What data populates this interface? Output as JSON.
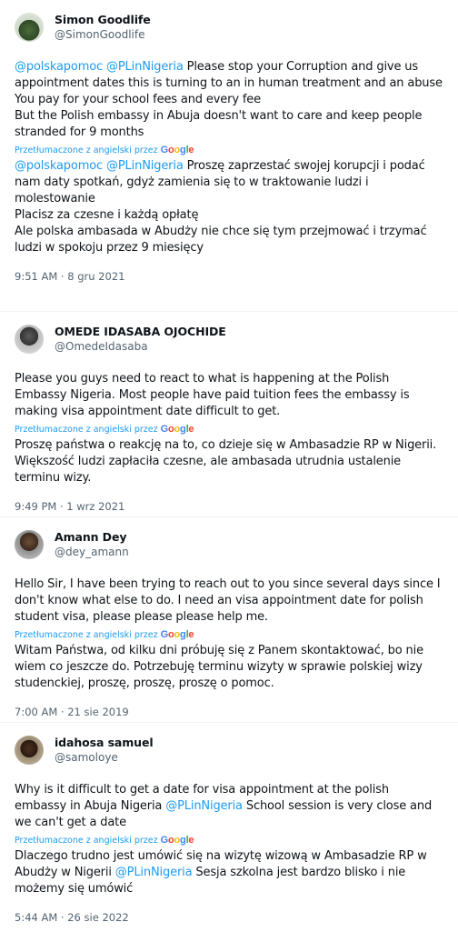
{
  "google": {
    "letters": [
      "G",
      "o",
      "o",
      "g",
      "l",
      "e"
    ],
    "colors": [
      "#4285f4",
      "#ea4335",
      "#fbbc05",
      "#4285f4",
      "#34a853",
      "#ea4335"
    ]
  },
  "colors": {
    "link": "#1d9bf0",
    "text": "#0f1419",
    "secondary": "#536471",
    "divider": "#eff3f4"
  },
  "tweets": [
    {
      "name": "Simon Goodlife",
      "handle": "@SimonGoodlife",
      "original": [
        [
          {
            "t": "@polskapomoc",
            "m": true
          },
          {
            "t": " "
          },
          {
            "t": "@PLinNigeria",
            "m": true
          },
          {
            "t": " Please stop your Corruption and give us appointment dates this is turning to an in human treatment and an abuse"
          }
        ],
        [
          {
            "t": "You pay for your school fees and every fee"
          }
        ],
        [
          {
            "t": "But the Polish embassy in Abuja doesn't want to care and keep people stranded for 9 months"
          }
        ]
      ],
      "translated_label": "Przetłumaczone z angielski przez",
      "translation": [
        [
          {
            "t": "@polskapomoc",
            "m": true
          },
          {
            "t": " "
          },
          {
            "t": "@PLinNigeria",
            "m": true
          },
          {
            "t": " Proszę zaprzestać swojej korupcji i podać nam daty spotkań, gdyż zamienia się to w traktowanie ludzi i molestowanie"
          }
        ],
        [
          {
            "t": "Placisz za czesne i każdą opłatę"
          }
        ],
        [
          {
            "t": "Ale polska ambasada w Abudży nie chce się tym przejmować i trzymać ludzi w spokoju przez 9 miesięcy"
          }
        ]
      ],
      "time": "9:51 AM · 8 gru 2021"
    },
    {
      "name": "OMEDE IDASABA OJOCHIDE",
      "handle": "@OmedeIdasaba",
      "original": [
        [
          {
            "t": "Please you guys need to react to what is happening at the Polish Embassy Nigeria. Most people have paid tuition fees the embassy is making visa appointment date difficult to get."
          }
        ]
      ],
      "translated_label": "Przetłumaczone z angielski przez",
      "translation": [
        [
          {
            "t": "Proszę państwa o reakcję na to, co dzieje się w Ambasadzie RP w Nigerii. Większość ludzi zapłaciła czesne, ale ambasada utrudnia ustalenie terminu wizy."
          }
        ]
      ],
      "time": "9:49 PM · 1 wrz 2021"
    },
    {
      "name": "Amann Dey",
      "handle": "@dey_amann",
      "original": [
        [
          {
            "t": "Hello Sir, I have been trying to reach out to you since several days since I don't know what else to do. I need an visa appointment date for polish student visa, please please please help me."
          }
        ]
      ],
      "translated_label": "Przetłumaczone z angielski przez",
      "translation": [
        [
          {
            "t": "Witam Państwa, od kilku dni próbuję się z Panem skontaktować, bo nie wiem co jeszcze do. Potrzebuję terminu wizyty w sprawie polskiej wizy studenckiej, proszę, proszę, proszę o pomoc."
          }
        ]
      ],
      "time": "7:00 AM · 21 sie 2019"
    },
    {
      "name": "idahosa samuel",
      "handle": "@samoloye",
      "original": [
        [
          {
            "t": "Why is it difficult to get a date for visa appointment at the polish embassy in Abuja Nigeria "
          },
          {
            "t": "@PLinNigeria",
            "m": true
          },
          {
            "t": "  School session is very close and we can't get a date"
          }
        ]
      ],
      "translated_label": "Przetłumaczone z angielski przez",
      "translation": [
        [
          {
            "t": "Dlaczego trudno jest umówić się na wizytę wizową w Ambasadzie RP w Abudży w Nigerii "
          },
          {
            "t": "@PLinNigeria",
            "m": true
          },
          {
            "t": " Sesja szkolna jest bardzo blisko i nie możemy się umówić"
          }
        ]
      ],
      "time": "5:44 AM · 26 sie 2022"
    }
  ]
}
